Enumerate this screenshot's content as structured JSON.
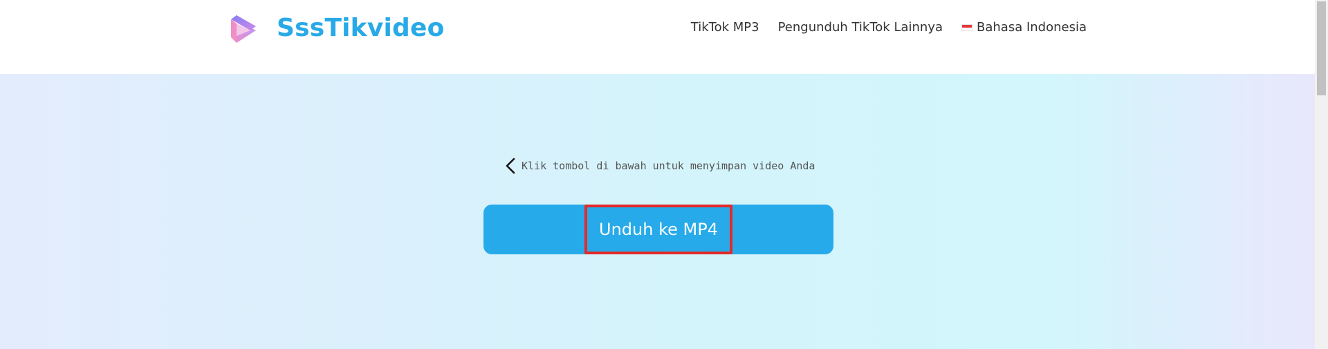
{
  "header": {
    "brand_name": "SssTikvideo",
    "logo_icon": "play-logo-icon",
    "nav": {
      "mp3_label": "TikTok MP3",
      "more_label": "Pengunduh TikTok Lainnya",
      "language_label": "Bahasa Indonesia",
      "language_flag": "indonesia-flag-icon"
    }
  },
  "main": {
    "hint_text": "Klik tombol di bawah untuk menyimpan video Anda",
    "hint_icon": "chevron-left-icon",
    "download_label": "Unduh ke MP4"
  },
  "colors": {
    "brand": "#28a9e8",
    "button": "#27aaea",
    "highlight_border": "#e32929"
  }
}
